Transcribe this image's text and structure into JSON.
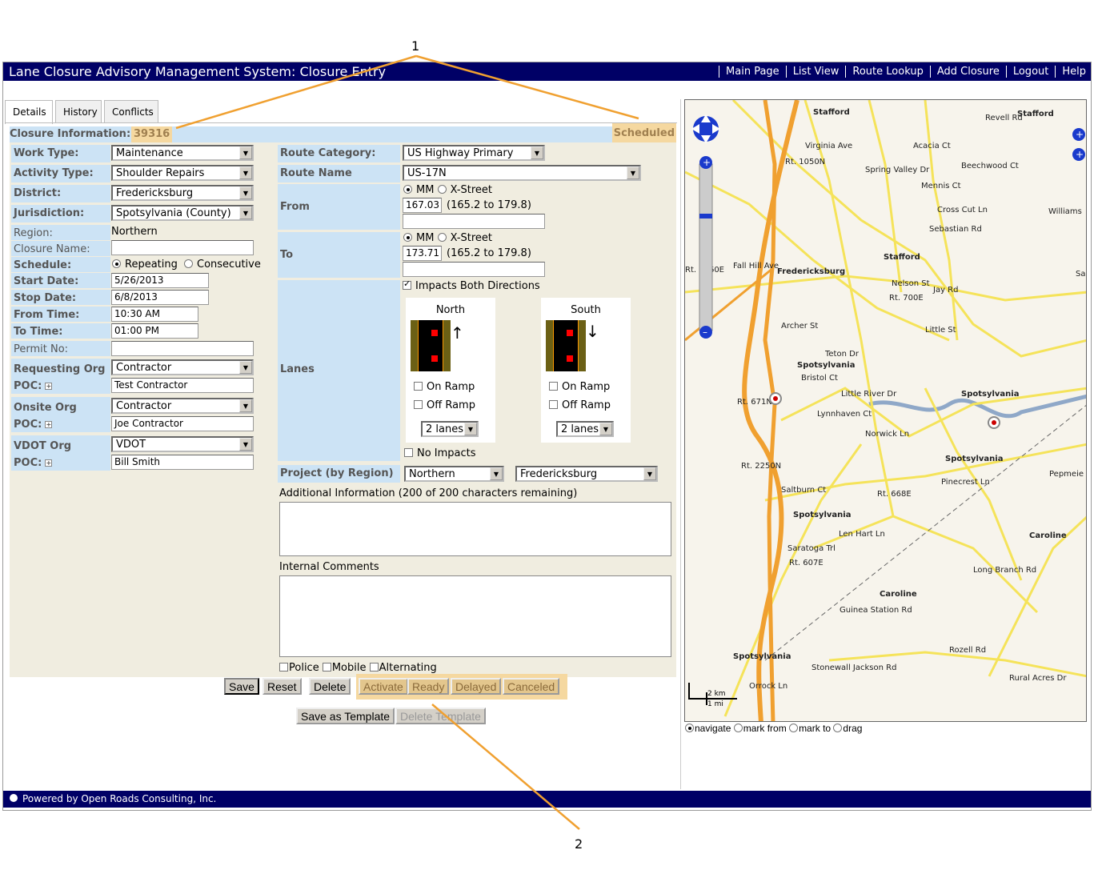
{
  "header": {
    "title": "Lane Closure Advisory Management System: Closure Entry",
    "nav": [
      "Main Page",
      "List View",
      "Route Lookup",
      "Add Closure",
      "Logout",
      "Help"
    ]
  },
  "tabs": [
    "Details",
    "History",
    "Conflicts"
  ],
  "closure": {
    "label": "Closure Information:",
    "id": "39316",
    "status": "Scheduled"
  },
  "left": {
    "work_type": {
      "label": "Work Type:",
      "value": "Maintenance"
    },
    "activity_type": {
      "label": "Activity Type:",
      "value": "Shoulder Repairs"
    },
    "district": {
      "label": "District:",
      "value": "Fredericksburg"
    },
    "jurisdiction": {
      "label": "Jurisdiction:",
      "value": "Spotsylvania (County)"
    },
    "region": {
      "label": "Region:",
      "value": "Northern"
    },
    "closure_name": {
      "label": "Closure Name:",
      "value": ""
    },
    "schedule": {
      "label": "Schedule:",
      "options": [
        "Repeating",
        "Consecutive"
      ],
      "selected": "Repeating"
    },
    "start_date": {
      "label": "Start Date:",
      "value": "5/26/2013"
    },
    "stop_date": {
      "label": "Stop Date:",
      "value": "6/8/2013"
    },
    "from_time": {
      "label": "From Time:",
      "value": "10:30 AM"
    },
    "to_time": {
      "label": "To Time:",
      "value": "01:00 PM"
    },
    "permit_no": {
      "label": "Permit No:",
      "value": ""
    },
    "requesting_org": {
      "label": "Requesting Org",
      "poc_label": "POC:",
      "value": "Contractor",
      "poc": "Test Contractor"
    },
    "onsite_org": {
      "label": "Onsite Org",
      "poc_label": "POC:",
      "value": "Contractor",
      "poc": "Joe Contractor"
    },
    "vdot_org": {
      "label": "VDOT Org",
      "poc_label": "POC:",
      "value": "VDOT",
      "poc": "Bill Smith"
    }
  },
  "right": {
    "route_category": {
      "label": "Route Category:",
      "value": "US Highway Primary"
    },
    "route_name": {
      "label": "Route Name",
      "value": "US-17N"
    },
    "from": {
      "label": "From",
      "mm": "MM",
      "xstreet": "X-Street",
      "value": "167.03",
      "range": "(165.2 to 179.8)"
    },
    "to": {
      "label": "To",
      "mm": "MM",
      "xstreet": "X-Street",
      "value": "173.71",
      "range": "(165.2 to 179.8)"
    },
    "impacts_both": "Impacts Both Directions",
    "lanes": {
      "label": "Lanes",
      "north": {
        "title": "North",
        "on_ramp": "On Ramp",
        "off_ramp": "Off Ramp",
        "count": "2 lanes"
      },
      "south": {
        "title": "South",
        "on_ramp": "On Ramp",
        "off_ramp": "Off Ramp",
        "count": "2 lanes"
      }
    },
    "no_impacts": "No Impacts",
    "project": {
      "label": "Project (by Region)",
      "region": "Northern",
      "district": "Fredericksburg"
    },
    "additional_info_label": "Additional Information (200 of 200 characters remaining)",
    "internal_comments_label": "Internal Comments",
    "flags": [
      "Police",
      "Mobile",
      "Alternating"
    ]
  },
  "buttons": {
    "save": "Save",
    "reset": "Reset",
    "delete": "Delete",
    "activate": "Activate",
    "ready": "Ready",
    "delayed": "Delayed",
    "canceled": "Canceled",
    "save_template": "Save as Template",
    "delete_template": "Delete Template"
  },
  "map": {
    "labels": [
      "Stafford",
      "Stafford",
      "Fredericksburg",
      "Stafford",
      "Spotsylvania",
      "Spotsylvania",
      "Spotsylvania",
      "Spotsylvania",
      "Caroline",
      "Caroline",
      "Spotsylvania",
      "Virginia Ave",
      "Spring Valley Dr",
      "Beechwood Ct",
      "Cross Cut Ln",
      "Sebastian Rd",
      "Nelson St",
      "Jay Rd",
      "Little St",
      "Teton Dr",
      "Archer St",
      "Bristol Ct",
      "Little River Dr",
      "Lynnhaven Ct",
      "Norwick Ln",
      "Pinecrest Ln",
      "Pepmeie",
      "Saltburn Ct",
      "Rt. 668E",
      "Len Hart Ln",
      "Saratoga Trl",
      "Rt. 607E",
      "Guinea Station Rd",
      "Long Branch Rd",
      "Stonewall Jackson Rd",
      "Rozell Rd",
      "Rural Acres Dr",
      "Orrock Ln",
      "Williams",
      "Sand",
      "Rt. 671N",
      "Rt. 2250N",
      "Rt. 1050N",
      "Rt. 700E",
      "Rt. 1160E",
      "Fall Hill Ave",
      "Mennis Ct",
      "Acacia Ct",
      "Revell Rd"
    ],
    "scale": [
      "2 km",
      "1 mi"
    ],
    "modes": [
      "navigate",
      "mark from",
      "mark to",
      "drag"
    ],
    "selected_mode": "navigate",
    "colors": {
      "interstate": "#f0a030",
      "road": "#f5e35a",
      "water": "#8fa8c8"
    }
  },
  "footer": "Powered by Open Roads Consulting, Inc.",
  "annotations": [
    "1",
    "2"
  ],
  "colors": {
    "header": "#000066",
    "label_bg": "#cce3f5",
    "panel": "#f0ede0",
    "status_highlight": "#f5d8a0",
    "annotation": "#f0a030"
  }
}
